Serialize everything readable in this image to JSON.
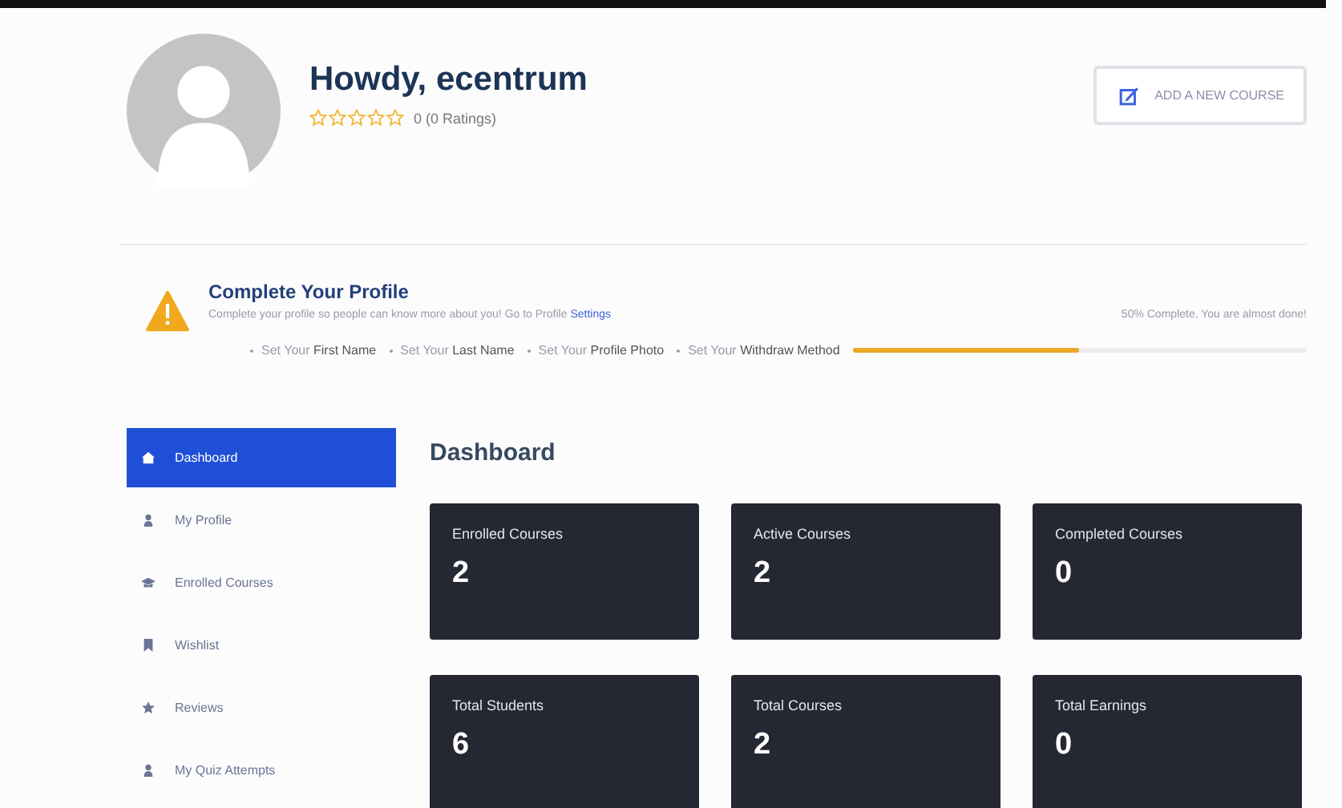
{
  "header": {
    "greeting": "Howdy, ecentrum",
    "stars": 0,
    "rating_text": "0 (0 Ratings)",
    "button": "ADD A NEW COURSE"
  },
  "profile_notice": {
    "title": "Complete Your Profile",
    "text": "Complete your profile so people can know more about you! Go to Profile ",
    "link": "Settings",
    "progress_text": "50% Complete, You are almost done!",
    "level": 0.5,
    "steps": [
      "Set Your **First Name**",
      "Set Your **Last Name**",
      "Set Your **Profile Photo**",
      "Set Your **Withdraw Method**"
    ]
  },
  "sidebar": {
    "items": [
      {
        "label": "Dashboard",
        "kind": "home",
        "selected": true
      },
      {
        "label": "My Profile",
        "kind": "profile",
        "selected": false
      },
      {
        "label": "Enrolled Courses",
        "kind": "courses",
        "selected": false
      },
      {
        "label": "Wishlist",
        "kind": "wishlist",
        "selected": false
      },
      {
        "label": "Reviews",
        "kind": "reviews",
        "selected": false
      },
      {
        "label": "My Quiz Attempts",
        "kind": "profile",
        "selected": false
      }
    ]
  },
  "dashboard": {
    "title": "Dashboard",
    "cards": [
      {
        "label": "Enrolled Courses",
        "value": "2"
      },
      {
        "label": "Active Courses",
        "value": "2"
      },
      {
        "label": "Completed Courses",
        "value": "0"
      },
      {
        "label": "Total Students",
        "value": "6"
      },
      {
        "label": "Total Courses",
        "value": "2"
      },
      {
        "label": "Total Earnings",
        "value": "0"
      }
    ]
  }
}
